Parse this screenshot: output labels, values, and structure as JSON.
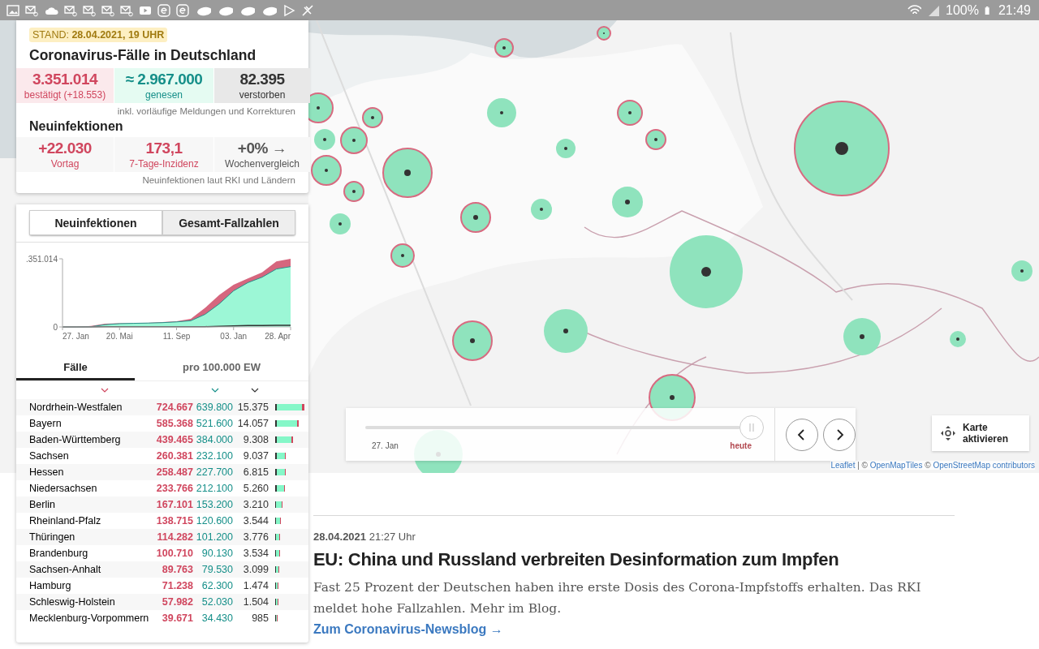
{
  "status_bar": {
    "battery": "100%",
    "time": "21:49"
  },
  "summary": {
    "stamp": "STAND: **28.04.2021, 19 UHR**",
    "title": "Coronavirus-Fälle in Deutschland",
    "totals": [
      {
        "kind": "confirmed",
        "value": "3.351.014",
        "label": "bestätigt (+18.553)"
      },
      {
        "kind": "recovered",
        "value": "≈ 2.967.000",
        "label": "genesen"
      },
      {
        "kind": "deaths",
        "value": "82.395",
        "label": "verstorben"
      }
    ],
    "totals_note": "inkl. vorläufige Meldungen und Korrekturen",
    "new_title": "Neuinfektionen",
    "new": [
      {
        "kind": "confirmed",
        "value": "+22.030",
        "label": "Vortag"
      },
      {
        "kind": "confirmed",
        "value": "173,1",
        "label": "7-Tage-Inzidenz"
      },
      {
        "kind": "deaths",
        "value": "+0% →",
        "label": "Wochenvergleich"
      }
    ],
    "new_note": "Neuinfektionen laut RKI und Ländern"
  },
  "mode_switch": [
    {
      "label": "Neuinfektionen",
      "selected": false
    },
    {
      "label": "Gesamt-Fallzahlen",
      "selected": true
    }
  ],
  "chart": {
    "y_labels": [
      ".351.014",
      "0"
    ],
    "x_labels": [
      "27. Jan",
      "20. Mai",
      "11. Sep",
      "03. Jan",
      "28. Apr"
    ]
  },
  "table_tabs": [
    {
      "label": "Fälle",
      "selected": true
    },
    {
      "label": "pro 100.000 EW",
      "selected": false
    }
  ],
  "rows": [
    {
      "name": "Nordrhein-Westfalen",
      "confirmed": "724.667",
      "recovered": "639.800",
      "deaths": "15.375"
    },
    {
      "name": "Bayern",
      "confirmed": "585.368",
      "recovered": "521.600",
      "deaths": "14.057"
    },
    {
      "name": "Baden-Württemberg",
      "confirmed": "439.465",
      "recovered": "384.000",
      "deaths": "9.308"
    },
    {
      "name": "Sachsen",
      "confirmed": "260.381",
      "recovered": "232.100",
      "deaths": "9.037"
    },
    {
      "name": "Hessen",
      "confirmed": "258.487",
      "recovered": "227.700",
      "deaths": "6.815"
    },
    {
      "name": "Niedersachsen",
      "confirmed": "233.766",
      "recovered": "212.100",
      "deaths": "5.260"
    },
    {
      "name": "Berlin",
      "confirmed": "167.101",
      "recovered": "153.200",
      "deaths": "3.210"
    },
    {
      "name": "Rheinland-Pfalz",
      "confirmed": "138.715",
      "recovered": "120.600",
      "deaths": "3.544"
    },
    {
      "name": "Thüringen",
      "confirmed": "114.282",
      "recovered": "101.200",
      "deaths": "3.776"
    },
    {
      "name": "Brandenburg",
      "confirmed": "100.710",
      "recovered": "90.130",
      "deaths": "3.534"
    },
    {
      "name": "Sachsen-Anhalt",
      "confirmed": "89.763",
      "recovered": "79.530",
      "deaths": "3.099"
    },
    {
      "name": "Hamburg",
      "confirmed": "71.238",
      "recovered": "62.300",
      "deaths": "1.474"
    },
    {
      "name": "Schleswig-Holstein",
      "confirmed": "57.982",
      "recovered": "52.030",
      "deaths": "1.504"
    },
    {
      "name": "Mecklenburg-Vorpommern",
      "confirmed": "39.671",
      "recovered": "34.430",
      "deaths": "985"
    }
  ],
  "map": {
    "kind": "picture",
    "timeline": {
      "start": "27. Jan",
      "end": "heute",
      "level": 1
    },
    "activate_button": "Karte aktivieren",
    "attribution": [
      {
        "kind": "link",
        "text": "Leaflet"
      },
      {
        "kind": "plain",
        "text": " | © "
      },
      {
        "kind": "link",
        "text": "OpenMapTiles"
      },
      {
        "kind": "plain",
        "text": " © "
      },
      {
        "kind": "link",
        "text": "OpenStreetMap contributors"
      }
    ]
  },
  "article": {
    "date": "28.04.2021",
    "time": "21:27 Uhr",
    "title": "EU: China und Russland verbreiten Desinformation zum Impfen",
    "teaser": "Fast 25 Prozent der Deutschen haben ihre erste Dosis des Corona-Impfstoffs erhalten. Das RKI meldet hohe Fallzahlen. Mehr im Blog.",
    "link": "Zum Coronavirus-Newsblog →"
  }
}
